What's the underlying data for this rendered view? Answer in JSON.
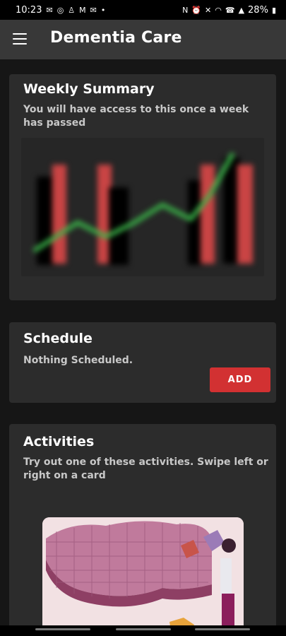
{
  "status_bar": {
    "time": "10:23",
    "battery": "28%",
    "left_icons": [
      "gmail-icon",
      "instagram-icon",
      "snapchat-icon",
      "gmail-icon",
      "email-icon",
      "dot"
    ],
    "right_icons": [
      "nfc-icon",
      "alarm-icon",
      "mute-icon",
      "wifi-icon",
      "call-icon",
      "signal-icon",
      "battery-icon"
    ]
  },
  "app_bar": {
    "title": "Dementia Care",
    "menu_icon": "hamburger-menu-icon"
  },
  "weekly_summary": {
    "title": "Weekly Summary",
    "subtitle": "You will have access to this once a week has passed"
  },
  "schedule": {
    "title": "Schedule",
    "empty_text": "Nothing Scheduled.",
    "add_label": "ADD"
  },
  "activities": {
    "title": "Activities",
    "subtitle": "Try out one of these activities. Swipe left or right on a card"
  },
  "colors": {
    "background": "#161616",
    "card": "#2c2c2c",
    "app_bar": "#383838",
    "accent": "#d23132",
    "chart_line": "#3bb84a"
  }
}
